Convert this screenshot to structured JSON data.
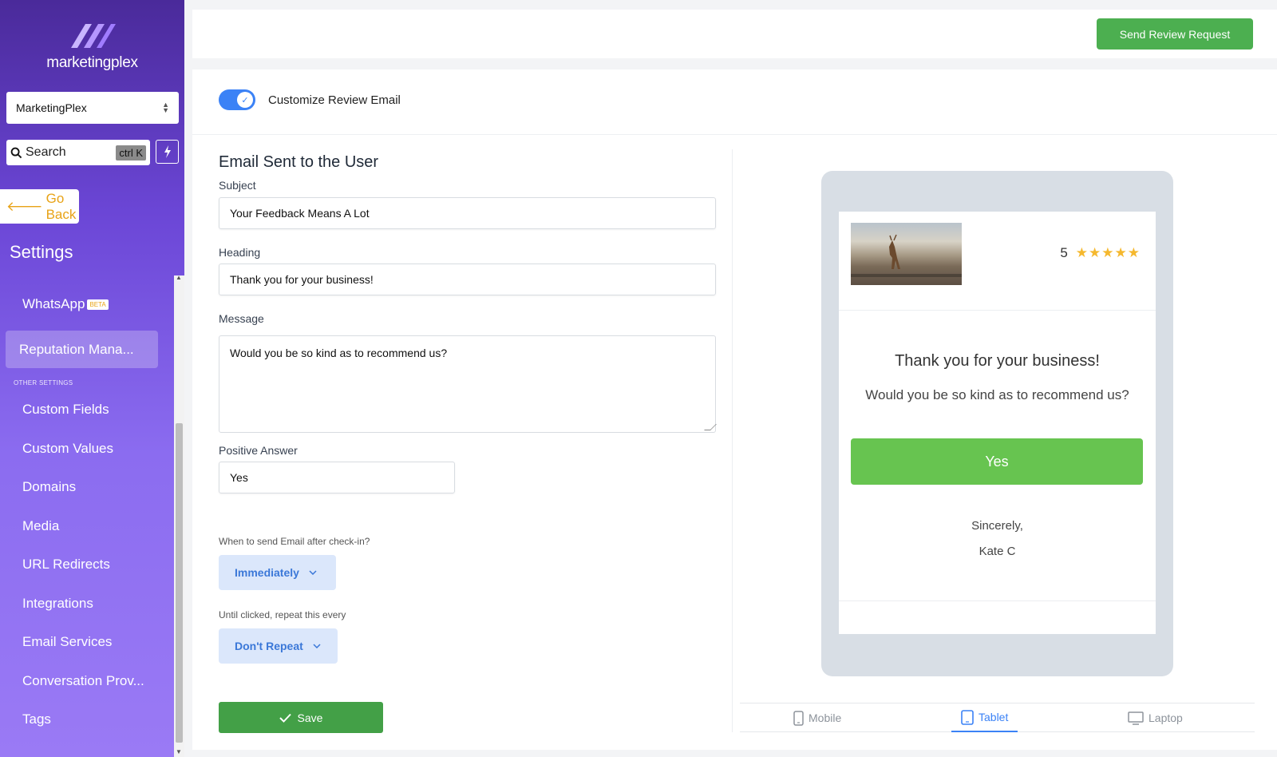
{
  "app": {
    "brand": "marketingplex"
  },
  "sidebar": {
    "location": "MarketingPlex",
    "search_placeholder": "Search",
    "search_shortcut": "ctrl K",
    "go_back": "Go Back",
    "title": "Settings",
    "items": [
      {
        "label": "WhatsApp",
        "badge": "BETA"
      },
      {
        "label": "Reputation Mana..."
      },
      {
        "label": "Custom Fields"
      },
      {
        "label": "Custom Values"
      },
      {
        "label": "Domains"
      },
      {
        "label": "Media"
      },
      {
        "label": "URL Redirects"
      },
      {
        "label": "Integrations"
      },
      {
        "label": "Email Services"
      },
      {
        "label": "Conversation Prov..."
      },
      {
        "label": "Tags"
      }
    ],
    "section_other": "OTHER SETTINGS"
  },
  "topbar": {
    "send_button": "Send Review Request"
  },
  "customize": {
    "label": "Customize Review Email",
    "enabled": true
  },
  "form": {
    "section_title": "Email Sent to the User",
    "subject_label": "Subject",
    "subject_value": "Your Feedback Means A Lot",
    "heading_label": "Heading",
    "heading_value": "Thank you for your business!",
    "message_label": "Message",
    "message_value": "Would you be so kind as to recommend us?",
    "positive_label": "Positive Answer",
    "positive_value": "Yes",
    "when_label": "When to send Email after check-in?",
    "when_value": "Immediately",
    "repeat_label": "Until clicked, repeat this every",
    "repeat_value": "Don't Repeat",
    "save": "Save"
  },
  "preview": {
    "rating": "5",
    "stars": "★★★★★",
    "heading": "Thank you for your business!",
    "message": "Would you be so kind as to recommend us?",
    "button": "Yes",
    "sign_off": "Sincerely,",
    "signer": "Kate C",
    "devices": [
      "Mobile",
      "Tablet",
      "Laptop"
    ],
    "active_device": "Tablet"
  },
  "colors": {
    "accent": "#3b82f6",
    "success": "#43a047",
    "sidebar": "#7b5ce6",
    "star": "#f5b82e"
  }
}
